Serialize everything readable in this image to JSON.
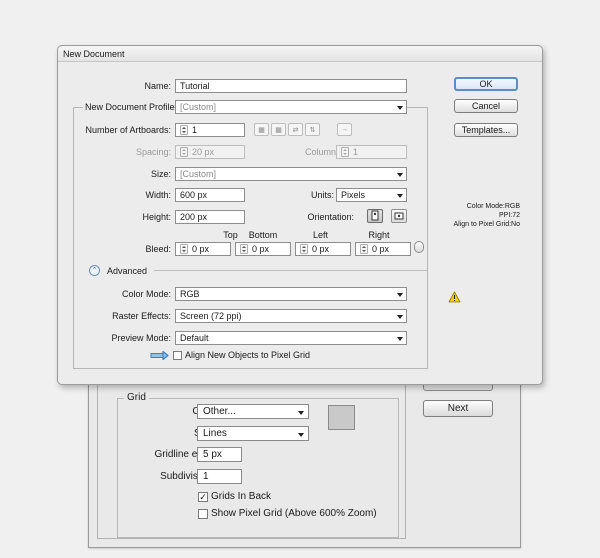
{
  "new_document": {
    "title": "New Document",
    "name_label": "Name:",
    "name_value": "Tutorial",
    "profile_label": "New Document Profile:",
    "profile_value": "[Custom]",
    "artboards_label": "Number of Artboards:",
    "artboards_value": "1",
    "spacing_label": "Spacing:",
    "spacing_value": "20 px",
    "columns_label": "Columns:",
    "columns_value": "1",
    "size_label": "Size:",
    "size_value": "[Custom]",
    "width_label": "Width:",
    "width_value": "600 px",
    "units_label": "Units:",
    "units_value": "Pixels",
    "height_label": "Height:",
    "height_value": "200 px",
    "orientation_label": "Orientation:",
    "bleed_label": "Bleed:",
    "bleed_headers": [
      "Top",
      "Bottom",
      "Left",
      "Right"
    ],
    "bleed_values": [
      "0 px",
      "0 px",
      "0 px",
      "0 px"
    ],
    "advanced_label": "Advanced",
    "color_mode_label": "Color Mode:",
    "color_mode_value": "RGB",
    "raster_label": "Raster Effects:",
    "raster_value": "Screen (72 ppi)",
    "preview_label": "Preview Mode:",
    "preview_value": "Default",
    "align_label": "Align New Objects to Pixel Grid",
    "ok_label": "OK",
    "cancel_label": "Cancel",
    "templates_label": "Templates...",
    "info_color_mode": "Color Mode:RGB",
    "info_ppi": "PPI:72",
    "info_align": "Align to Pixel Grid:No",
    "warning_icon": "warning-icon",
    "arrow_icon": "blue-arrow-icon",
    "accent_color": "#5b8ec6"
  },
  "grid_prefs": {
    "group_title": "Grid",
    "color_label": "Color:",
    "color_value": "Other...",
    "color_swatch": "#c9c9c9",
    "style_label": "Style:",
    "style_value": "Lines",
    "gridline_label": "Gridline every:",
    "gridline_value": "5 px",
    "subdivisions_label": "Subdivisions:",
    "subdivisions_value": "1",
    "grids_in_back_label": "Grids In Back",
    "grids_in_back_checked": true,
    "pixel_grid_label": "Show Pixel Grid (Above 600% Zoom)",
    "pixel_grid_checked": false,
    "next_label": "Next"
  }
}
